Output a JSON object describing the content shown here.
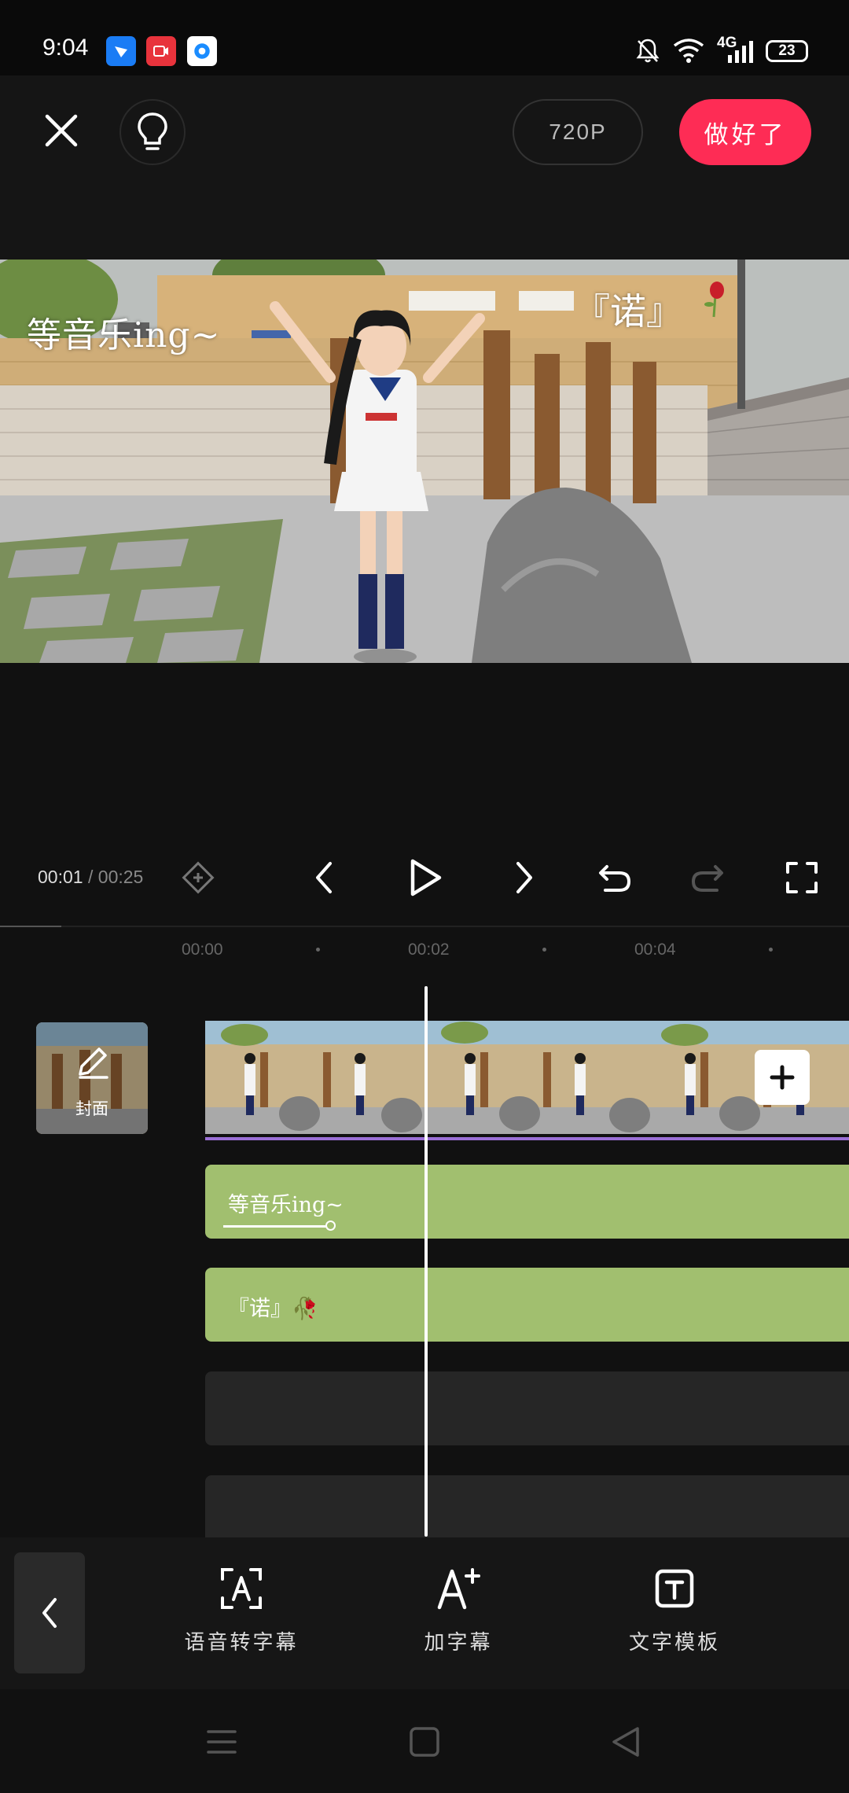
{
  "status_bar": {
    "time": "9:04",
    "network": "4G",
    "battery": "23"
  },
  "top_bar": {
    "resolution": "720P",
    "done_label": "做好了",
    "done_color": "#fe2c55"
  },
  "preview": {
    "overlay_text_1": "等音乐ing~",
    "overlay_text_2": "『诺』"
  },
  "playback": {
    "current_time": "00:01",
    "total_time": "/ 00:25"
  },
  "ruler": {
    "labels": [
      "00:00",
      "00:02",
      "00:04"
    ]
  },
  "timeline": {
    "cover_label": "封面",
    "text_tracks": [
      {
        "text": "等音乐ing~"
      },
      {
        "text": "『诺』🥀"
      }
    ],
    "track_color": "#a1bf6f",
    "video_underline_color": "#9b6fd6"
  },
  "bottom_toolbar": {
    "tools": [
      {
        "label": "语音转字幕",
        "icon": "speech-to-subtitle-icon"
      },
      {
        "label": "加字幕",
        "icon": "add-subtitle-icon"
      },
      {
        "label": "文字模板",
        "icon": "text-template-icon"
      }
    ]
  }
}
